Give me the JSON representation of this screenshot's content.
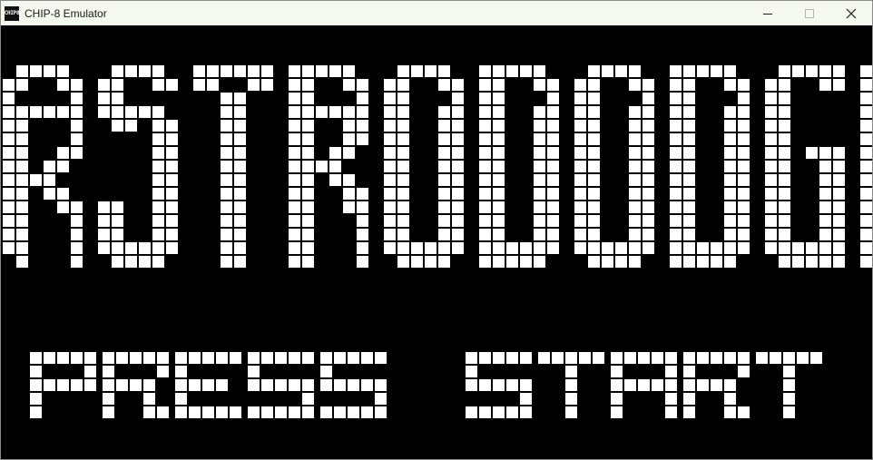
{
  "window": {
    "title": "CHIP-8 Emulator",
    "icon_text": "CHIP8",
    "icon": "chip8-app-icon",
    "controls": [
      "minimize-icon",
      "maximize-icon",
      "close-icon"
    ]
  },
  "display": {
    "logo_text": "ASTRODODGE",
    "prompt_text": "PRESS START",
    "pixel_color": "#ffffff",
    "background_color": "#000000"
  }
}
